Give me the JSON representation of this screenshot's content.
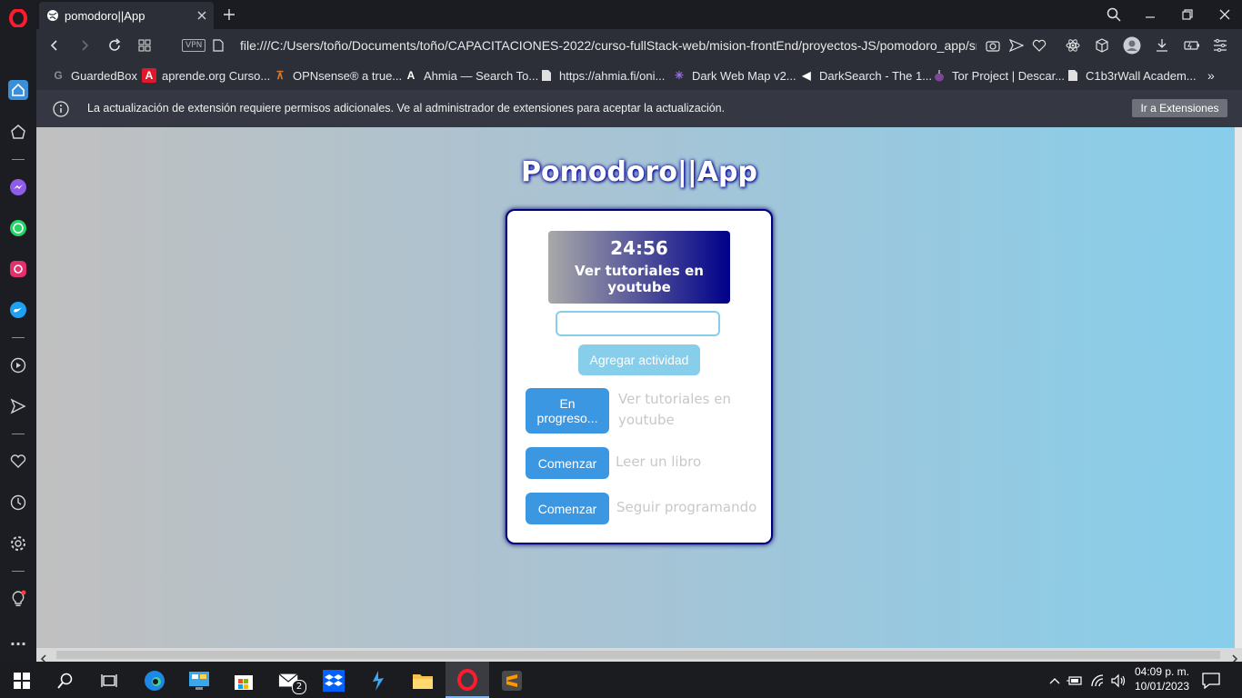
{
  "browser": {
    "tab_title": "pomodoro||App",
    "url": "file:///C:/Users/toño/Documents/toño/CAPACITACIONES-2022/curso-fullStack-web/mision-frontEnd/proyectos-JS/pomodoro_app/src/index.h",
    "vpn_label": "VPN",
    "bookmarks": [
      {
        "label": "GuardedBox"
      },
      {
        "label": "aprende.org Curso..."
      },
      {
        "label": "OPNsense® a true..."
      },
      {
        "label": "Ahmia — Search To..."
      },
      {
        "label": "https://ahmia.fi/oni..."
      },
      {
        "label": "Dark Web Map v2..."
      },
      {
        "label": "DarkSearch - The 1..."
      },
      {
        "label": "Tor Project | Descar..."
      },
      {
        "label": "C1b3rWall Academ..."
      }
    ],
    "notice_text": "La actualización de extensión requiere permisos adicionales. Ve al administrador de extensiones para aceptar la actualización.",
    "notice_button": "Ir a Extensiones"
  },
  "app": {
    "title": "Pomodoro||App",
    "timer": "24:56",
    "current_task": "Ver tutoriales en youtube",
    "input_value": "",
    "add_button": "Agregar actividad",
    "tasks": [
      {
        "button": "En progreso...",
        "text": "Ver tutoriales en youtube"
      },
      {
        "button": "Comenzar",
        "text": "Leer un libro"
      },
      {
        "button": "Comenzar",
        "text": "Seguir programando"
      }
    ]
  },
  "taskbar": {
    "mail_badge": "2",
    "time": "04:09 p. m.",
    "date": "10/01/2023"
  },
  "colors": {
    "accent_blue": "#3c97e3",
    "sky": "#87ceeb",
    "navy": "#000080"
  }
}
